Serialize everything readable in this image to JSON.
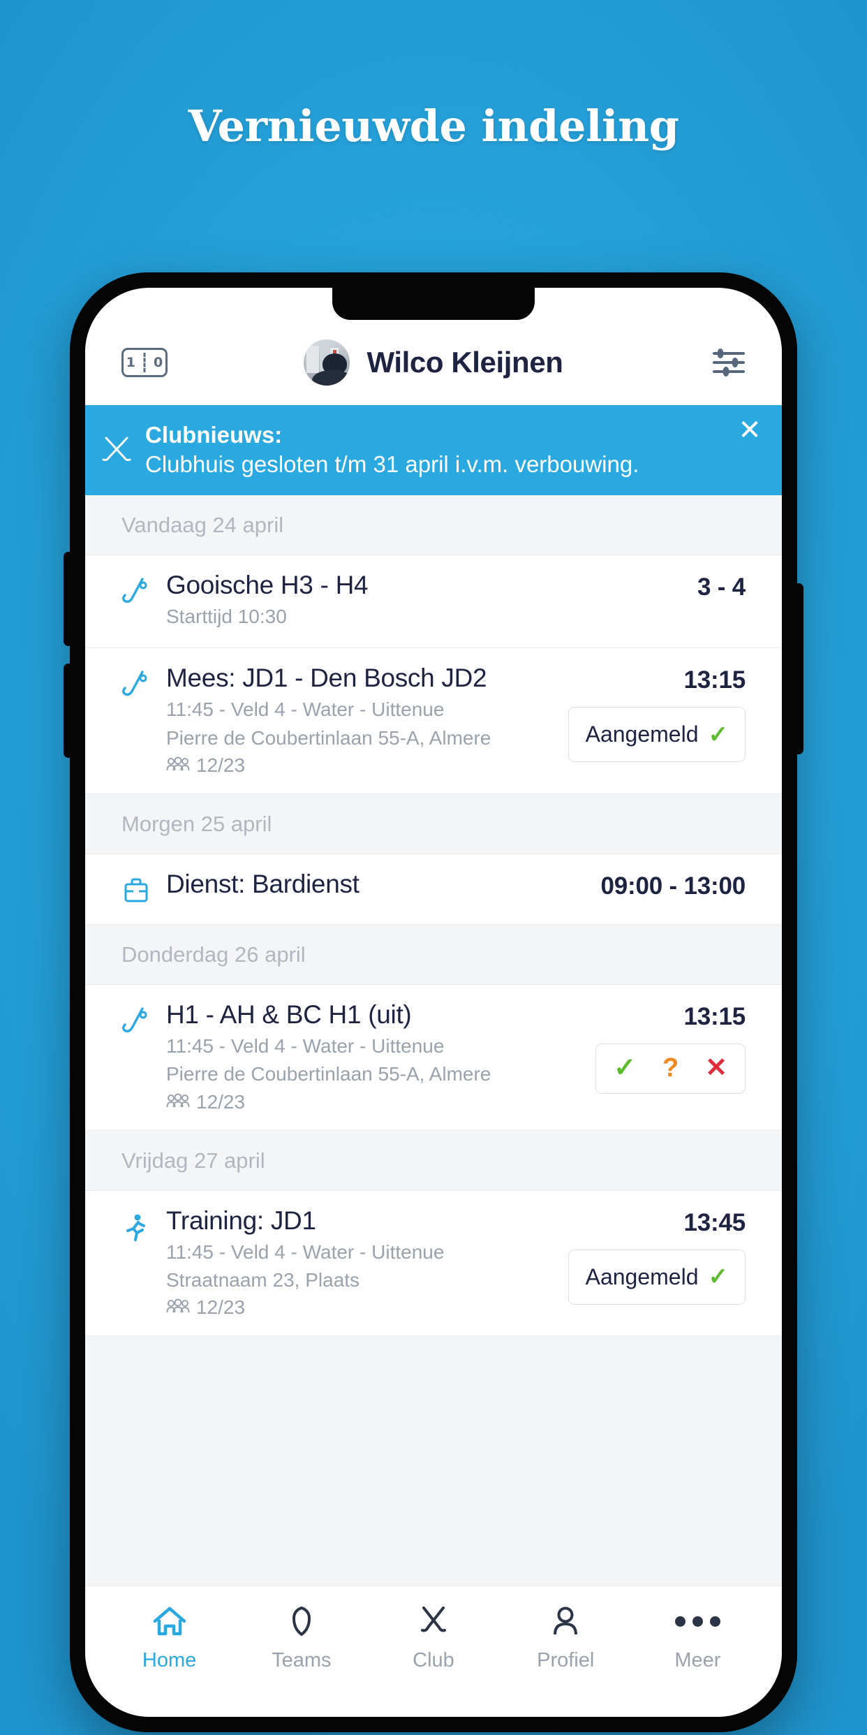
{
  "page": {
    "headline": "Vernieuwde indeling",
    "background_color": "#29aae3"
  },
  "header": {
    "scoreboard_icon": "scoreboard-icon",
    "scoreboard_home": "1",
    "scoreboard_away": "0",
    "avatar": "user-avatar",
    "user_name": "Wilco Kleijnen",
    "filter_icon": "filter-sliders-icon"
  },
  "banner": {
    "icon": "crossed-hockey-sticks-icon",
    "title": "Clubnieuws:",
    "message": "Clubhuis gesloten t/m 31 april i.v.m. verbouwing.",
    "close_label": "✕",
    "color": "#29a9e0"
  },
  "agenda": [
    {
      "day": "Vandaag 24 april",
      "events": [
        {
          "icon": "hockey-stick-icon",
          "title": "Gooische H3 - H4",
          "sub1": "Starttijd 10:30",
          "sub2": "",
          "count": "",
          "time": "3 - 4",
          "action": "score"
        }
      ]
    },
    {
      "day": "Morgen 25 april",
      "events": [
        {
          "icon": "briefcase-icon",
          "title": "Dienst: Bardienst",
          "sub1": "",
          "sub2": "",
          "count": "",
          "time": "09:00 - 13:00",
          "action": "none"
        }
      ]
    },
    {
      "day": "Donderdag 26 april",
      "events": [
        {
          "icon": "hockey-stick-icon",
          "title": "H1 - AH & BC H1 (uit)",
          "sub1": "11:45 - Veld 4 - Water - Uittenue",
          "sub2": "Pierre de Coubertinlaan 55-A, Almere",
          "count": "12/23",
          "time": "13:15",
          "action": "respond"
        }
      ]
    },
    {
      "day": "Vrijdag 27 april",
      "events": [
        {
          "icon": "running-person-icon",
          "title": "Training: JD1",
          "sub1": "11:45 - Veld 4 - Water - Uittenue",
          "sub2": "Straatnaam 23, Plaats",
          "count": "12/23",
          "time": "13:45",
          "action": "registered"
        }
      ]
    }
  ],
  "event_extra": {
    "icon": "hockey-stick-icon",
    "title": "Mees: JD1 - Den Bosch JD2",
    "sub1": "11:45 - Veld 4 - Water - Uittenue",
    "sub2": "Pierre de Coubertinlaan 55-A, Almere",
    "count": "12/23",
    "time": "13:15"
  },
  "labels": {
    "registered": "Aangemeld",
    "check": "✓",
    "yes": "✓",
    "maybe": "?",
    "no": "✕",
    "attendance_icon": "people-group-icon"
  },
  "tabbar": {
    "items": [
      {
        "label": "Home",
        "icon": "home-icon",
        "active": true
      },
      {
        "label": "Teams",
        "icon": "shield-icon",
        "active": false
      },
      {
        "label": "Club",
        "icon": "crossed-sticks-icon",
        "active": false
      },
      {
        "label": "Profiel",
        "icon": "person-icon",
        "active": false
      },
      {
        "label": "Meer",
        "icon": "ellipsis-icon",
        "active": false
      }
    ]
  },
  "colors": {
    "accent": "#29a9e0",
    "dark": "#1d2340",
    "muted": "#9aa2ac",
    "green": "#5cbb2a",
    "orange": "#f08a1e",
    "red": "#e02b3a"
  }
}
